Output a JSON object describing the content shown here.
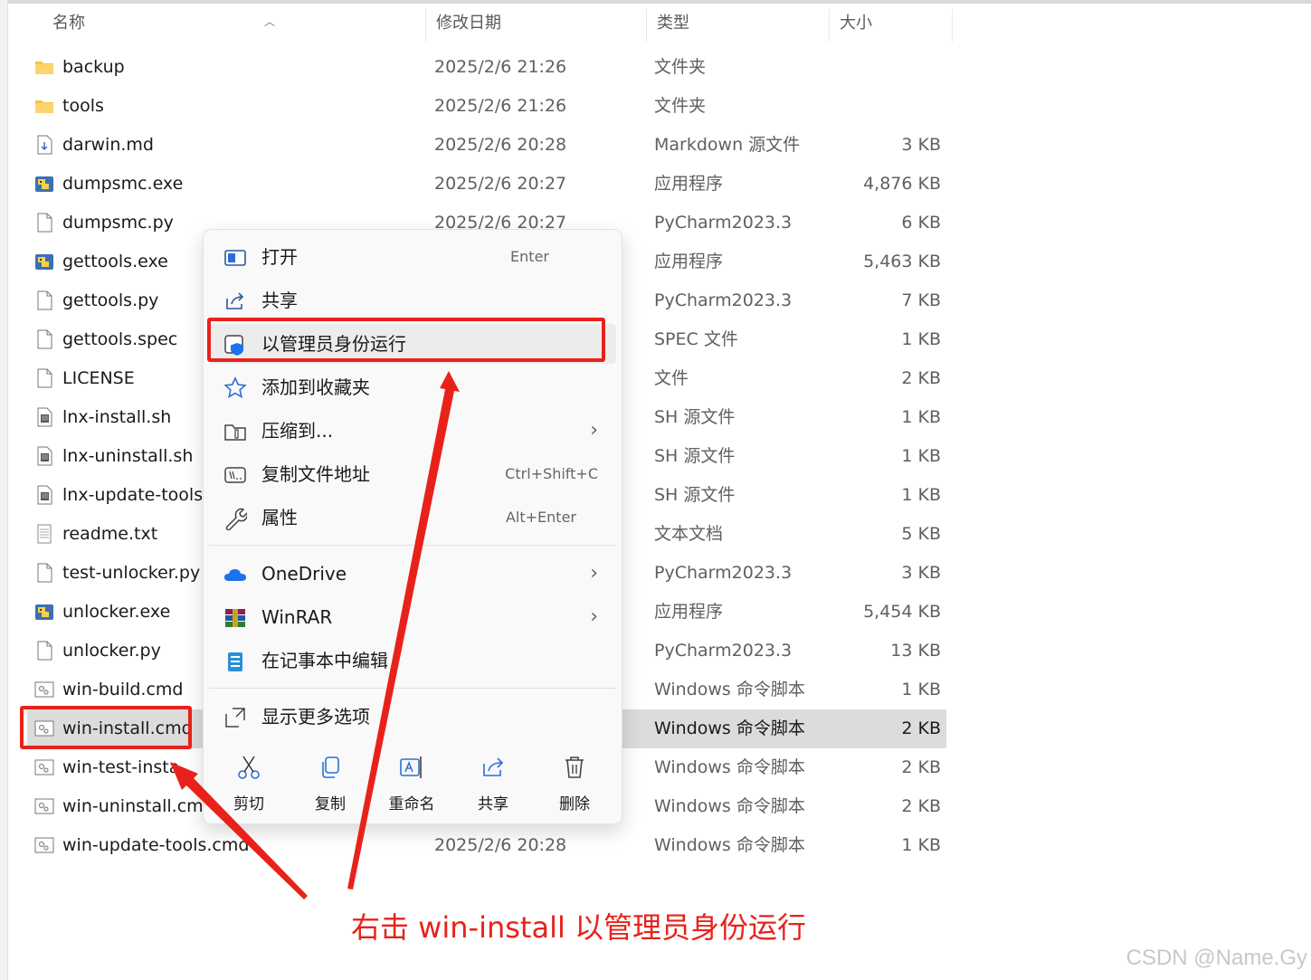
{
  "columns": {
    "name": "名称",
    "date": "修改日期",
    "type": "类型",
    "size": "大小"
  },
  "files": [
    {
      "name": "backup",
      "date": "2025/2/6 21:26",
      "type": "文件夹",
      "size": "",
      "icon": "folder-icon"
    },
    {
      "name": "tools",
      "date": "2025/2/6 21:26",
      "type": "文件夹",
      "size": "",
      "icon": "folder-icon"
    },
    {
      "name": "darwin.md",
      "date": "2025/2/6 20:28",
      "type": "Markdown 源文件",
      "size": "3 KB",
      "icon": "markdown-file-icon"
    },
    {
      "name": "dumpsmc.exe",
      "date": "2025/2/6 20:27",
      "type": "应用程序",
      "size": "4,876 KB",
      "icon": "python-exe-icon"
    },
    {
      "name": "dumpsmc.py",
      "date": "2025/2/6 20:27",
      "type": "PyCharm2023.3",
      "size": "6 KB",
      "icon": "file-icon"
    },
    {
      "name": "gettools.exe",
      "date": "",
      "type": "应用程序",
      "size": "5,463 KB",
      "icon": "python-exe-icon"
    },
    {
      "name": "gettools.py",
      "date": "",
      "type": "PyCharm2023.3",
      "size": "7 KB",
      "icon": "file-icon"
    },
    {
      "name": "gettools.spec",
      "date": "",
      "type": "SPEC 文件",
      "size": "1 KB",
      "icon": "file-icon"
    },
    {
      "name": "LICENSE",
      "date": "",
      "type": "文件",
      "size": "2 KB",
      "icon": "file-icon"
    },
    {
      "name": "lnx-install.sh",
      "date": "",
      "type": "SH 源文件",
      "size": "1 KB",
      "icon": "script-file-icon"
    },
    {
      "name": "lnx-uninstall.sh",
      "date": "",
      "type": "SH 源文件",
      "size": "1 KB",
      "icon": "script-file-icon"
    },
    {
      "name": "lnx-update-tools.s",
      "date": "",
      "type": "SH 源文件",
      "size": "1 KB",
      "icon": "script-file-icon"
    },
    {
      "name": "readme.txt",
      "date": "",
      "type": "文本文档",
      "size": "5 KB",
      "icon": "text-file-icon"
    },
    {
      "name": "test-unlocker.py",
      "date": "",
      "type": "PyCharm2023.3",
      "size": "3 KB",
      "icon": "file-icon"
    },
    {
      "name": "unlocker.exe",
      "date": "",
      "type": "应用程序",
      "size": "5,454 KB",
      "icon": "python-exe-icon"
    },
    {
      "name": "unlocker.py",
      "date": "",
      "type": "PyCharm2023.3",
      "size": "13 KB",
      "icon": "file-icon"
    },
    {
      "name": "win-build.cmd",
      "date": "",
      "type": "Windows 命令脚本",
      "size": "1 KB",
      "icon": "cmd-file-icon"
    },
    {
      "name": "win-install.cmd",
      "date": "",
      "type": "Windows 命令脚本",
      "size": "2 KB",
      "icon": "cmd-file-icon"
    },
    {
      "name": "win-test-insta",
      "date": "",
      "type": "Windows 命令脚本",
      "size": "2 KB",
      "icon": "cmd-file-icon"
    },
    {
      "name": "win-uninstall.cmd",
      "date": "",
      "type": "Windows 命令脚本",
      "size": "2 KB",
      "icon": "cmd-file-icon"
    },
    {
      "name": "win-update-tools.cmd",
      "date": "2025/2/6 20:28",
      "type": "Windows 命令脚本",
      "size": "1 KB",
      "icon": "cmd-file-icon"
    }
  ],
  "selected_file": "win-install.cmd",
  "context_menu": {
    "open": {
      "label": "打开",
      "shortcut": "Enter",
      "icon": "open-icon"
    },
    "share": {
      "label": "共享",
      "icon": "share-icon"
    },
    "run_as_admin": {
      "label": "以管理员身份运行",
      "icon": "shield-icon"
    },
    "add_favorites": {
      "label": "添加到收藏夹",
      "icon": "star-icon"
    },
    "compress": {
      "label": "压缩到...",
      "icon": "zip-icon"
    },
    "copy_path": {
      "label": "复制文件地址",
      "shortcut": "Ctrl+Shift+C",
      "icon": "copy-path-icon"
    },
    "properties": {
      "label": "属性",
      "shortcut": "Alt+Enter",
      "icon": "wrench-icon"
    },
    "onedrive": {
      "label": "OneDrive",
      "icon": "cloud-icon"
    },
    "winrar": {
      "label": "WinRAR",
      "icon": "winrar-icon"
    },
    "notepad": {
      "label": "在记事本中编辑",
      "icon": "notepad-icon"
    },
    "more_options": {
      "label": "显示更多选项",
      "icon": "more-options-icon"
    },
    "quick_actions": [
      {
        "label": "剪切",
        "icon": "scissors-icon"
      },
      {
        "label": "复制",
        "icon": "copy-icon"
      },
      {
        "label": "重命名",
        "icon": "rename-icon"
      },
      {
        "label": "共享",
        "icon": "share-icon"
      },
      {
        "label": "删除",
        "icon": "trash-icon"
      }
    ]
  },
  "annotation": "右击 win-install 以管理员身份运行",
  "watermark": "CSDN @Name.Gy",
  "colors": {
    "annotation_red": "#e8221a",
    "selection": "#dcdcdc",
    "menu_bg": "#f9f9f9"
  }
}
